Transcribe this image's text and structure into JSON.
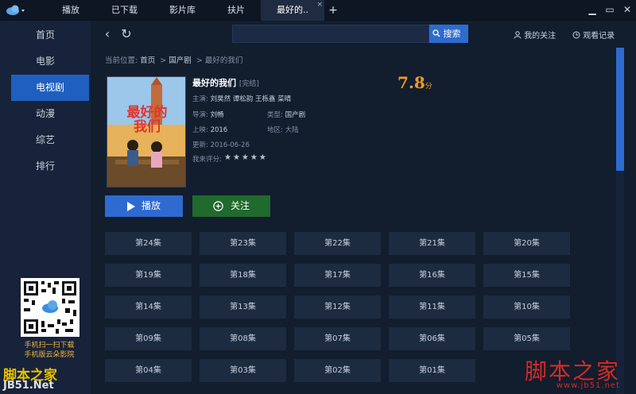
{
  "titlebar": {
    "tabs": [
      {
        "label": "播放"
      },
      {
        "label": "已下载"
      },
      {
        "label": "影片库"
      },
      {
        "label": "扶片"
      },
      {
        "label": "最好的.."
      }
    ],
    "add_label": "+",
    "close_tab_label": "×",
    "window_controls": [
      "▁",
      "▭",
      "✕"
    ]
  },
  "sidebar": {
    "items": [
      {
        "label": "首页"
      },
      {
        "label": "电影"
      },
      {
        "label": "电视剧"
      },
      {
        "label": "动漫"
      },
      {
        "label": "综艺"
      },
      {
        "label": "排行"
      }
    ],
    "qr_caption_1": "手机扫一扫下载",
    "qr_caption_2": "手机版云朵影院"
  },
  "toolbar": {
    "back_icon": "‹",
    "refresh_icon": "↻",
    "search_placeholder": "",
    "search_label": "搜索",
    "follow_label": "我的关注",
    "history_label": "观看记录"
  },
  "breadcrumb": {
    "prefix": "当前位置:",
    "home": "首页",
    "sep": ">",
    "category": "国产剧",
    "current": "最好的我们"
  },
  "detail": {
    "title": "最好的我们",
    "status": "[完结]",
    "score": "7.8",
    "score_unit": "分",
    "cast_label": "主演:",
    "cast": "刘昊然  谭松韵  王栎鑫  菜晴",
    "director_label": "导演:",
    "director": "刘畅",
    "type_label": "类型:",
    "type": "国产剧",
    "release_label": "上映:",
    "release": "2016",
    "region_label": "地区:",
    "region": "大陆",
    "update_label": "更新:",
    "update": "2016-06-26",
    "rating_label": "我来评分:",
    "stars": "★★★★★",
    "play_label": "播放",
    "follow_label": "关注"
  },
  "episodes": [
    "第24集",
    "第23集",
    "第22集",
    "第21集",
    "第20集",
    "第19集",
    "第18集",
    "第17集",
    "第16集",
    "第15集",
    "第14集",
    "第13集",
    "第12集",
    "第11集",
    "第10集",
    "第09集",
    "第08集",
    "第07集",
    "第06集",
    "第05集",
    "第04集",
    "第03集",
    "第02集",
    "第01集"
  ],
  "watermark": {
    "left_1": "脚本之家",
    "left_2": "JB51.Net",
    "right_1": "脚本之家",
    "right_2": "www.jb51.net"
  },
  "colors": {
    "accent": "#2d6bcf",
    "follow_green": "#1f6a2c",
    "score_orange": "#f29b1e"
  }
}
